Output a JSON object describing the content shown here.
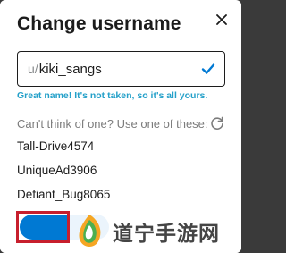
{
  "dialog": {
    "title": "Change username",
    "close_icon": "close-icon"
  },
  "username_field": {
    "prefix": "u/",
    "value": "kiki_sangs",
    "status_icon": "checkmark-icon",
    "status_color": "#0079d3"
  },
  "helper_text": "Great name! It's not taken, so it's all yours.",
  "suggestions": {
    "heading": "Can't think of one? Use one of these:",
    "refresh_icon": "refresh-icon",
    "items": [
      "Tall-Drive4574",
      "UniqueAd3906",
      "Defiant_Bug8065"
    ]
  },
  "save_button": {
    "color": "#0079d3",
    "highlight_color": "#c71f2d"
  },
  "watermark": {
    "text": "道宁手游网"
  }
}
